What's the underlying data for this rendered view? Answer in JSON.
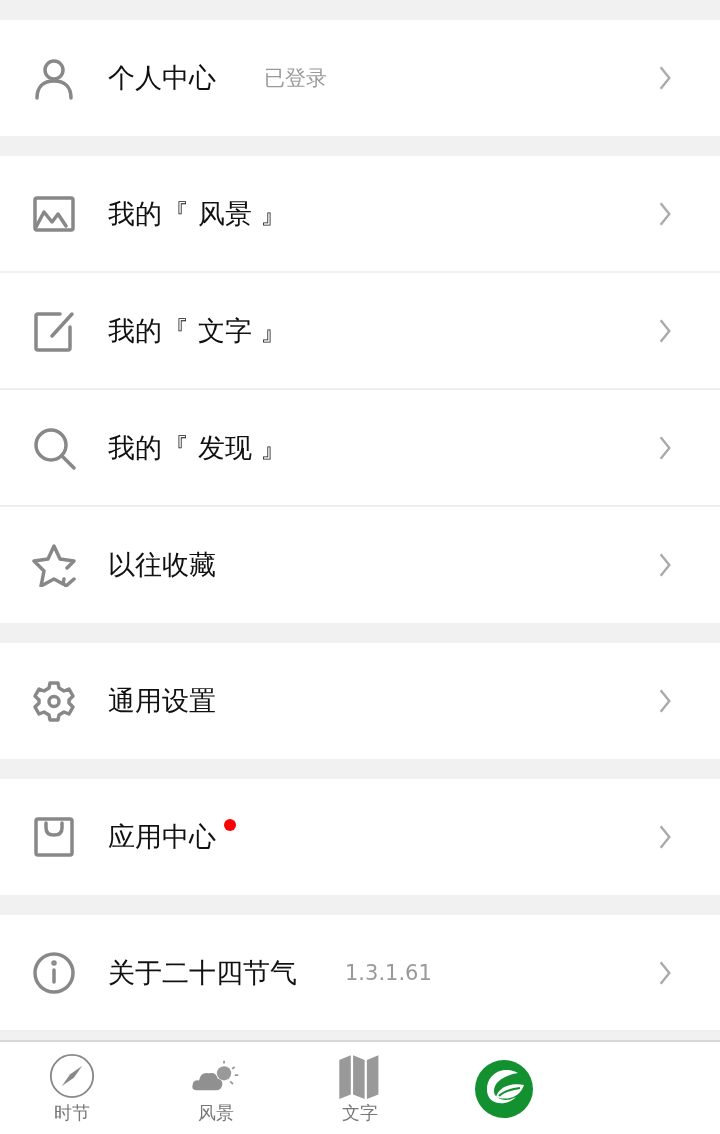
{
  "sections": [
    {
      "items": [
        {
          "label": "个人中心",
          "note": "已登录",
          "dot": false
        }
      ]
    },
    {
      "items": [
        {
          "label": "我的『 风景 』",
          "dot": false
        },
        {
          "label": "我的『 文字 』",
          "dot": false
        },
        {
          "label": "我的『 发现 』",
          "dot": false
        },
        {
          "label": "以往收藏",
          "dot": false
        }
      ]
    },
    {
      "items": [
        {
          "label": "通用设置",
          "dot": false
        }
      ]
    },
    {
      "items": [
        {
          "label": "应用中心",
          "dot": true
        }
      ]
    },
    {
      "items": [
        {
          "label": "关于二十四节气",
          "note": "1.3.1.61",
          "dot": false
        }
      ]
    }
  ],
  "tab_bar": [
    {
      "kind": "compass",
      "label": "时节"
    },
    {
      "kind": "weather",
      "label": "风景"
    },
    {
      "kind": "map",
      "label": "文字"
    },
    {
      "kind": "logo"
    }
  ]
}
